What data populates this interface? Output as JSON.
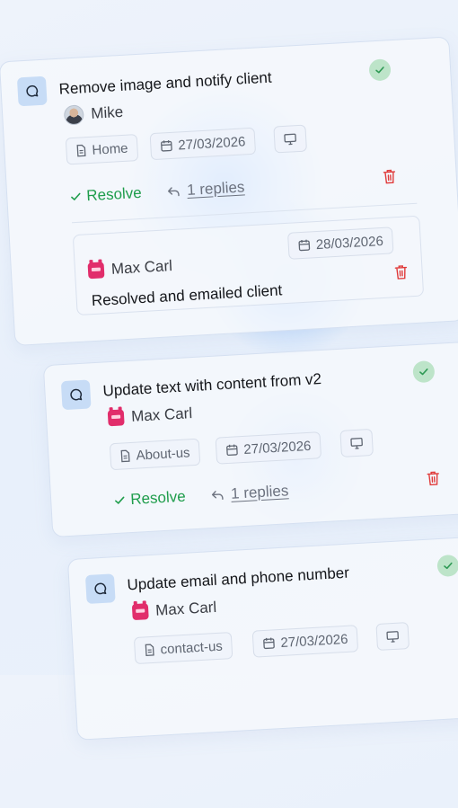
{
  "colors": {
    "resolve_green": "#1f9d4c",
    "trash_red": "#e03a3a",
    "bubble_bg": "#c7dcf6",
    "check_bg": "#bde4c9",
    "bot_avatar": "#e12d6b"
  },
  "comments": [
    {
      "title": "Remove image and notify client",
      "author": "Mike",
      "avatar": "photo",
      "page": "Home",
      "date": "27/03/2026",
      "resolve_label": "Resolve",
      "replies_label": "1 replies",
      "reply": {
        "author": "Max Carl",
        "date": "28/03/2026",
        "text": "Resolved and emailed client"
      }
    },
    {
      "title": "Update text with content from v2",
      "author": "Max Carl",
      "avatar": "bot",
      "page": "About-us",
      "date": "27/03/2026",
      "resolve_label": "Resolve",
      "replies_label": "1 replies"
    },
    {
      "title": "Update email and phone number",
      "author": "Max Carl",
      "avatar": "bot",
      "page": "contact-us",
      "date": "27/03/2026"
    }
  ],
  "icons": {
    "bubble": "chat-bubble-icon",
    "page": "page-icon",
    "date": "calendar-icon",
    "device": "desktop-icon",
    "check": "check-icon",
    "reply": "reply-arrow-icon",
    "delete": "trash-icon"
  }
}
